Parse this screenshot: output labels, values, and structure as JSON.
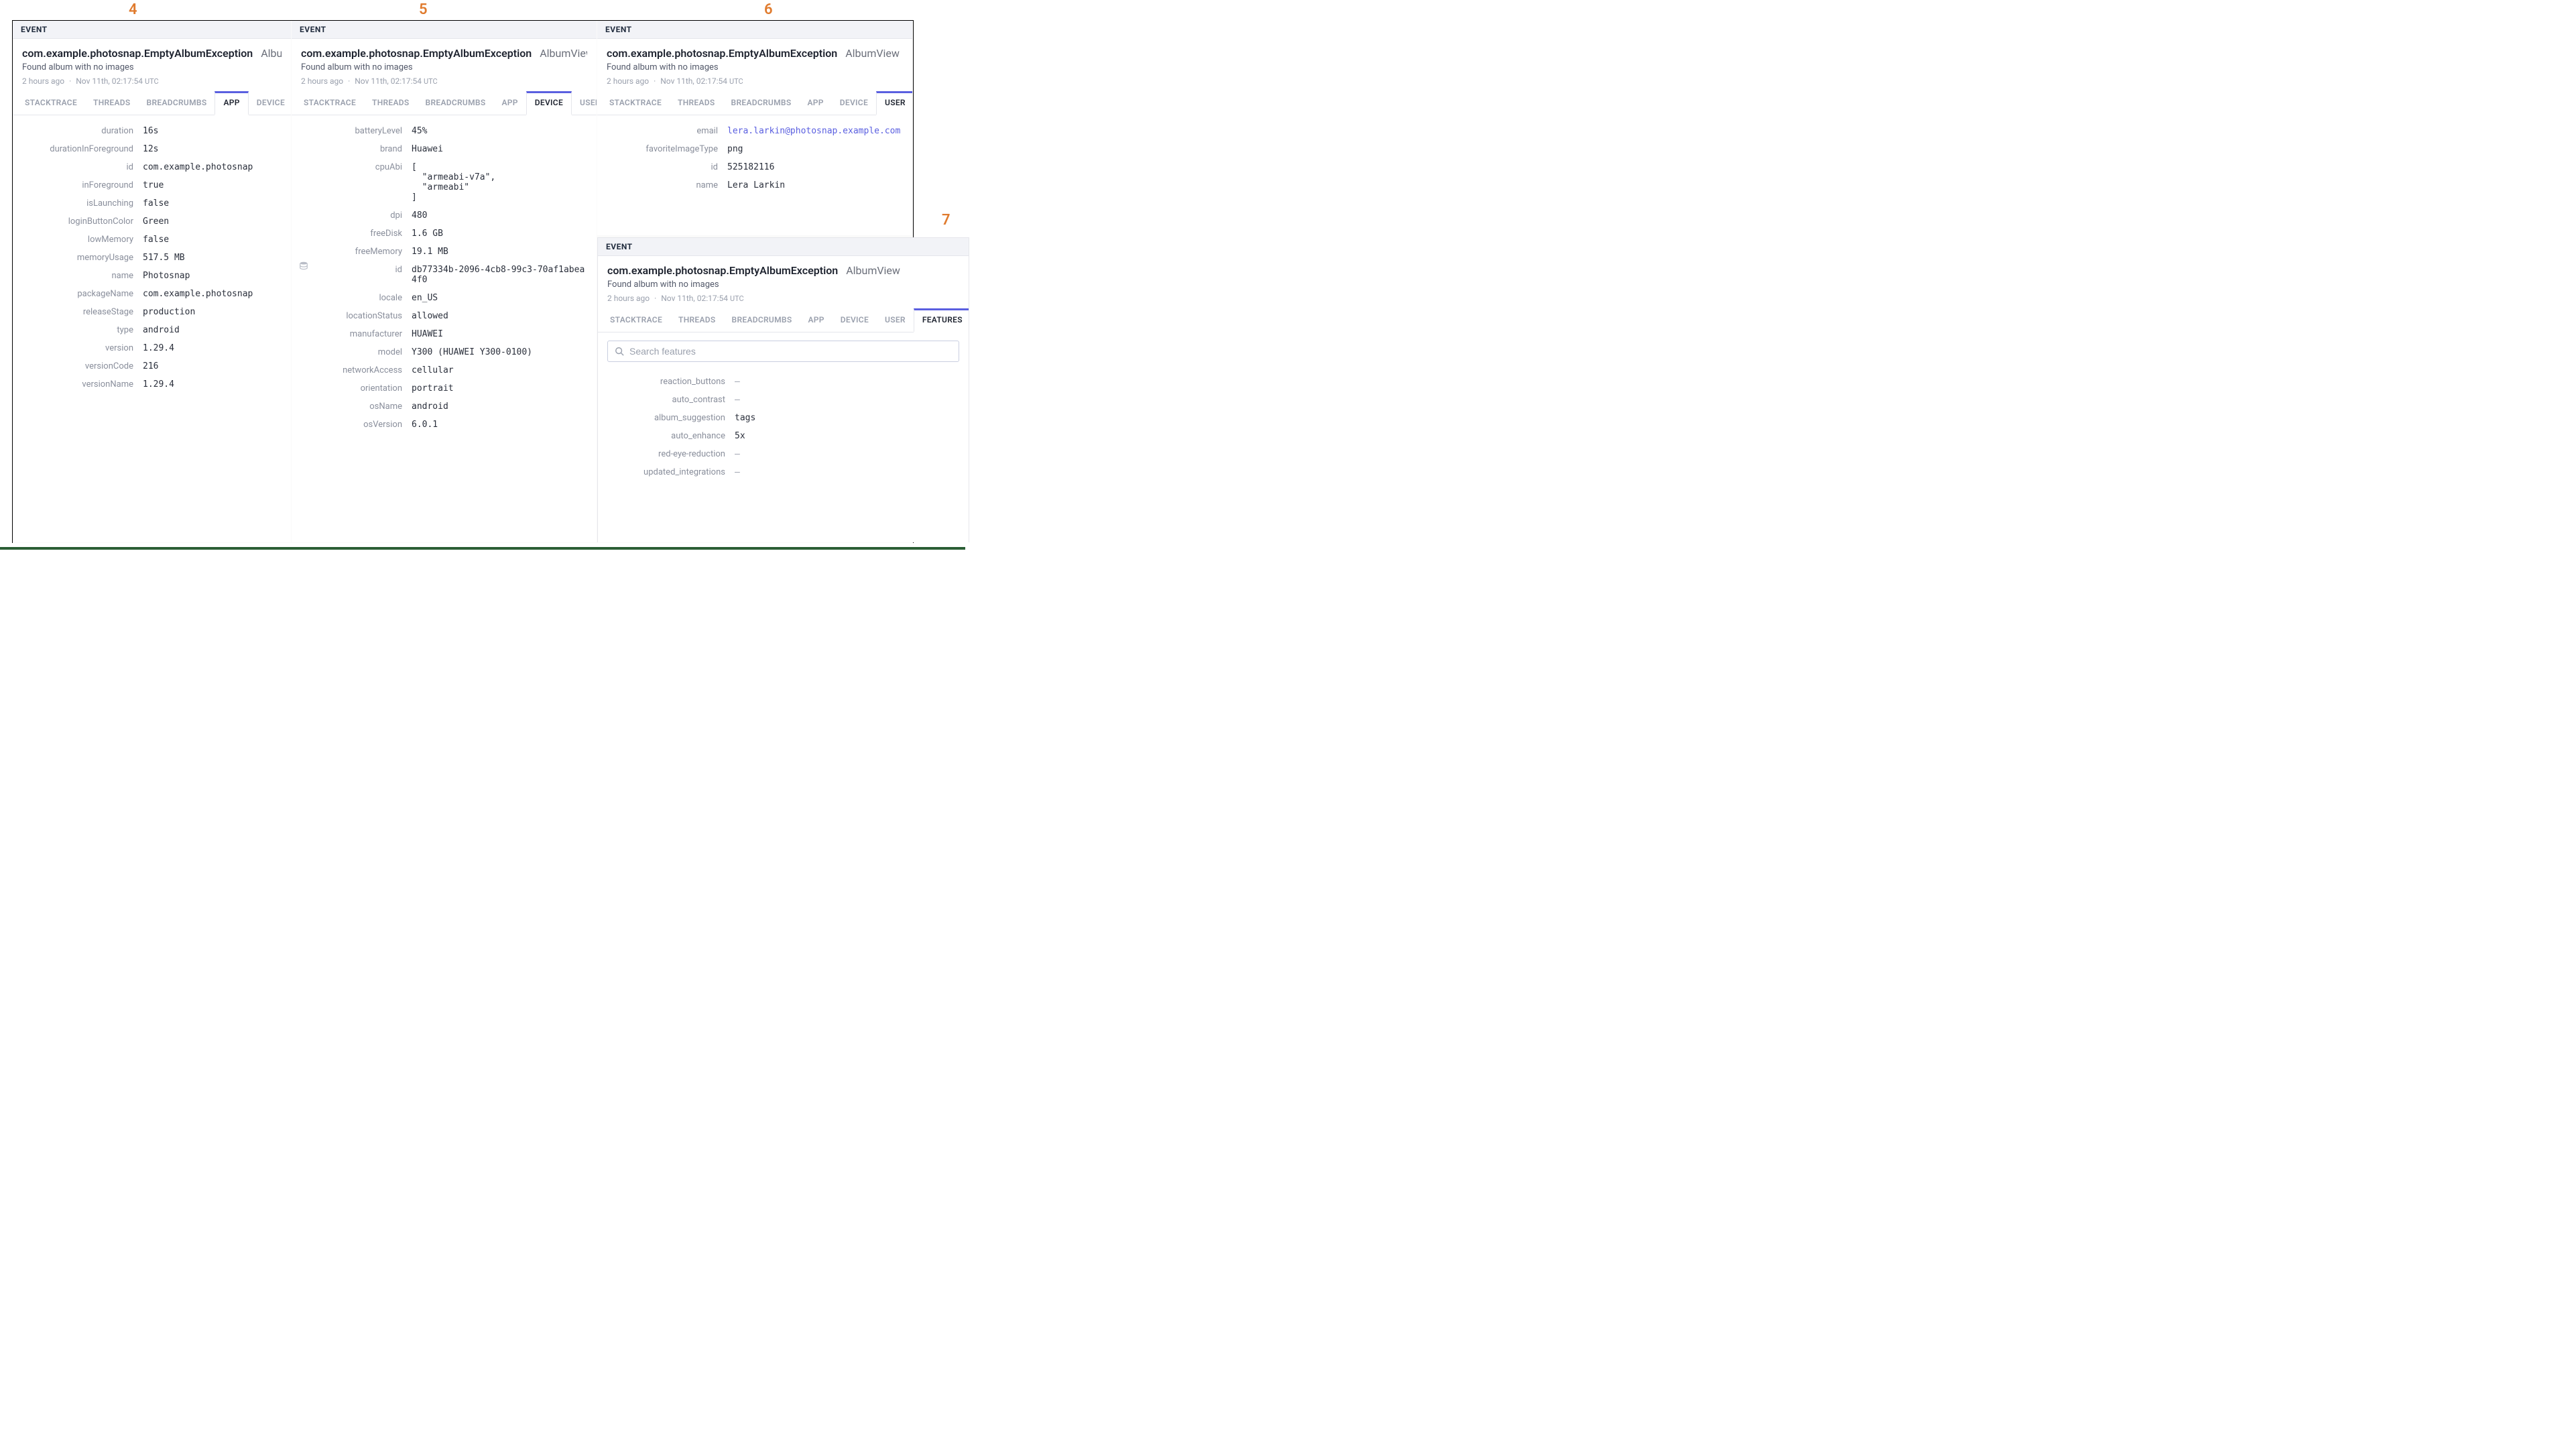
{
  "labels": {
    "event": "EVENT"
  },
  "common": {
    "exception": "com.example.photosnap.EmptyAlbumException",
    "context_full": "AlbumView",
    "context_trunc": "Album",
    "message": "Found album with no images",
    "rel_time": "2 hours ago",
    "abs_time": "Nov 11th, 02:17:54",
    "tz": "UTC"
  },
  "tabs": {
    "stacktrace": "STACKTRACE",
    "threads": "THREADS",
    "breadcrumbs": "BREADCRUMBS",
    "app": "APP",
    "device": "DEVICE",
    "user": "USER",
    "features": "FEATURES"
  },
  "panel4": {
    "num": "4",
    "rows": {
      "duration_k": "duration",
      "duration_v": "16s",
      "dif_k": "durationInForeground",
      "dif_v": "12s",
      "id_k": "id",
      "id_v": "com.example.photosnap",
      "ifg_k": "inForeground",
      "ifg_v": "true",
      "isl_k": "isLaunching",
      "isl_v": "false",
      "lbc_k": "loginButtonColor",
      "lbc_v": "Green",
      "lm_k": "lowMemory",
      "lm_v": "false",
      "mu_k": "memoryUsage",
      "mu_v": "517.5 MB",
      "name_k": "name",
      "name_v": "Photosnap",
      "pkg_k": "packageName",
      "pkg_v": "com.example.photosnap",
      "rs_k": "releaseStage",
      "rs_v": "production",
      "type_k": "type",
      "type_v": "android",
      "ver_k": "version",
      "ver_v": "1.29.4",
      "vc_k": "versionCode",
      "vc_v": "216",
      "vn_k": "versionName",
      "vn_v": "1.29.4"
    }
  },
  "panel5": {
    "num": "5",
    "rows": {
      "bat_k": "batteryLevel",
      "bat_v": "45%",
      "brand_k": "brand",
      "brand_v": "Huawei",
      "cpu_k": "cpuAbi",
      "cpu_v": "[\n  \"armeabi-v7a\",\n  \"armeabi\"\n]",
      "dpi_k": "dpi",
      "dpi_v": "480",
      "fd_k": "freeDisk",
      "fd_v": "1.6 GB",
      "fm_k": "freeMemory",
      "fm_v": "19.1 MB",
      "id_k": "id",
      "id_v": "db77334b-2096-4cb8-99c3-70af1abea4f0",
      "loc_k": "locale",
      "loc_v": "en_US",
      "ls_k": "locationStatus",
      "ls_v": "allowed",
      "man_k": "manufacturer",
      "man_v": "HUAWEI",
      "model_k": "model",
      "model_v": "Y300 (HUAWEI Y300-0100)",
      "net_k": "networkAccess",
      "net_v": "cellular",
      "ori_k": "orientation",
      "ori_v": "portrait",
      "osn_k": "osName",
      "osn_v": "android",
      "osv_k": "osVersion",
      "osv_v": "6.0.1"
    }
  },
  "panel6": {
    "num": "6",
    "rows": {
      "email_k": "email",
      "email_v": "lera.larkin@photosnap.example.com",
      "fit_k": "favoriteImageType",
      "fit_v": "png",
      "id_k": "id",
      "id_v": "525182116",
      "name_k": "name",
      "name_v": "Lera Larkin"
    }
  },
  "panel7": {
    "num": "7",
    "search_placeholder": "Search features",
    "rows": {
      "rb_k": "reaction_buttons",
      "rb_v": "–",
      "ac_k": "auto_contrast",
      "ac_v": "–",
      "as_k": "album_suggestion",
      "as_v": "tags",
      "ae_k": "auto_enhance",
      "ae_v": "5x",
      "rer_k": "red-eye-reduction",
      "rer_v": "–",
      "ui_k": "updated_integrations",
      "ui_v": "–"
    }
  }
}
